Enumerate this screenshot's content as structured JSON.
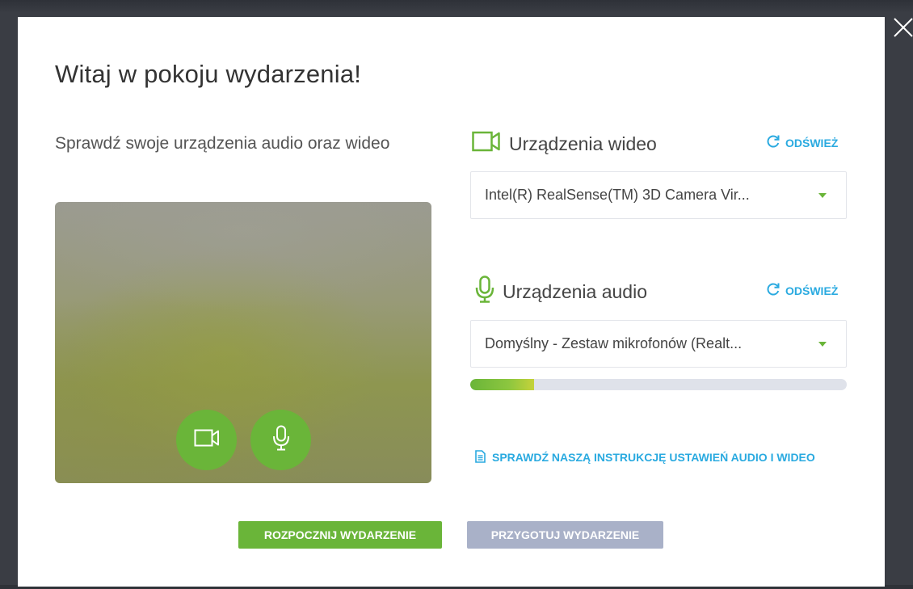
{
  "dialog": {
    "title": "Witaj w pokoju wydarzenia!",
    "subtitle": "Sprawdź swoje urządzenia audio oraz wideo"
  },
  "preview": {
    "camera_button_icon": "video-camera-icon",
    "mic_button_icon": "microphone-icon"
  },
  "video": {
    "section_label": "Urządzenia wideo",
    "refresh_label": "ODŚWIEŻ",
    "selected_device": "Intel(R) RealSense(TM) 3D Camera Vir..."
  },
  "audio": {
    "section_label": "Urządzenia audio",
    "refresh_label": "ODŚWIEŻ",
    "selected_device": "Domyślny - Zestaw mikrofonów (Realt...",
    "input_level": 0.17
  },
  "instruction_link": "SPRAWDŹ NASZĄ INSTRUKCJĘ USTAWIEŃ AUDIO I WIDEO",
  "actions": {
    "start_label": "ROZPOCZNIJ WYDARZENIE",
    "prepare_label": "PRZYGOTUJ WYDARZENIE"
  },
  "colors": {
    "accent_green": "#6ab539",
    "link_blue": "#2aaae0",
    "disabled_button": "#a9b1c8"
  }
}
